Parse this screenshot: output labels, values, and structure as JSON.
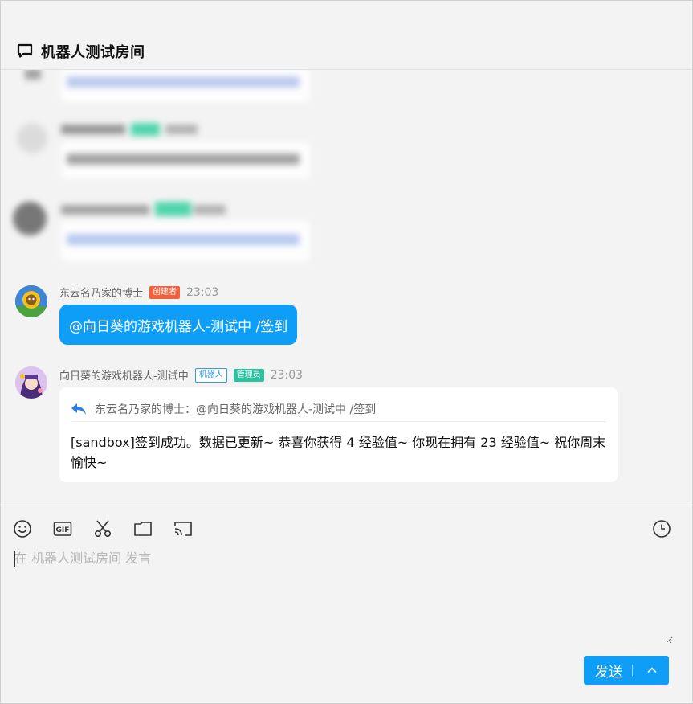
{
  "header": {
    "title": "机器人测试房间",
    "icon": "chat-bubble-icon"
  },
  "messages": [
    {
      "sender": "东云名乃家的博士",
      "badges": [
        "创建者"
      ],
      "time": "23:03",
      "text": "@向日葵的游戏机器人-测试中 /签到"
    },
    {
      "sender": "向日葵的游戏机器人-测试中",
      "badges": [
        "机器人",
        "管理员"
      ],
      "time": "23:03",
      "quote": "东云名乃家的博士：@向日葵的游戏机器人-测试中 /签到",
      "text": "[sandbox]签到成功。数据已更新~ 恭喜你获得 4 经验值~ 你现在拥有 23 经验值~ 祝你周末愉快~"
    }
  ],
  "toolbar": {
    "icons": [
      "emoji-icon",
      "gif-icon",
      "scissors-icon",
      "folder-icon",
      "screen-share-icon",
      "clock-icon"
    ]
  },
  "composer": {
    "placeholder": "在 机器人测试房间 发言",
    "send_label": "发送"
  },
  "colors": {
    "accent": "#0f9ef7",
    "creator": "#f0623c",
    "admin": "#2ac39e"
  }
}
